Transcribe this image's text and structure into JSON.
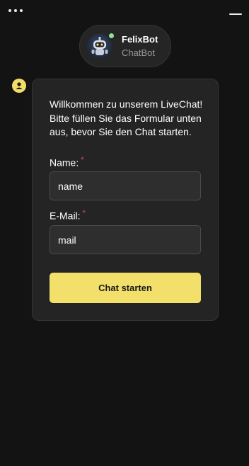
{
  "window": {
    "menu_icon": "more-horizontal-icon",
    "minimize_icon": "minimize-icon"
  },
  "bot": {
    "name": "FelixBot",
    "role": "ChatBot",
    "avatar_icon": "robot-avatar",
    "status": "online",
    "status_color": "#8ee09a"
  },
  "message": {
    "sender_icon": "user-icon",
    "welcome_text": "Willkommen zu unserem LiveChat! Bitte füllen Sie das Formular unten aus, bevor Sie den Chat starten."
  },
  "form": {
    "name_label": "Name:",
    "name_required_mark": "*",
    "name_value": "name",
    "email_label": "E-Mail:",
    "email_required_mark": "*",
    "email_value": "mail",
    "submit_label": "Chat starten"
  },
  "colors": {
    "background": "#131313",
    "card": "#242424",
    "accent": "#f3e06b",
    "required": "#e25252"
  }
}
